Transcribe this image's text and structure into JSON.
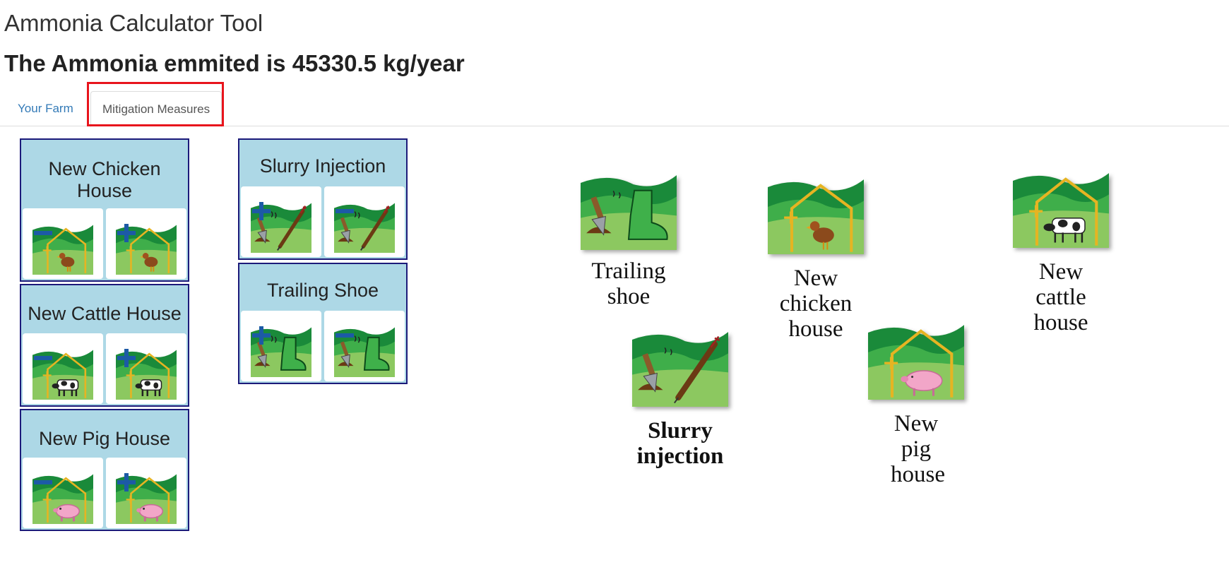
{
  "app": {
    "title": "Ammonia Calculator Tool",
    "result_text": "The Ammonia emmited is 45330.5 kg/year"
  },
  "tabs": [
    {
      "label": "Your Farm",
      "active": false
    },
    {
      "label": "Mitigation Measures",
      "active": true
    }
  ],
  "measure_cards": [
    {
      "title": "New Chicken House",
      "buttons": [
        "minus",
        "plus"
      ],
      "icon": "chicken-house-icon"
    },
    {
      "title": "New Cattle House",
      "buttons": [
        "minus",
        "plus"
      ],
      "icon": "cattle-house-icon"
    },
    {
      "title": "New Pig House",
      "buttons": [
        "minus",
        "plus"
      ],
      "icon": "pig-house-icon"
    },
    {
      "title": "Slurry Injection",
      "buttons": [
        "plus",
        "minus"
      ],
      "icon": "slurry-injection-icon"
    },
    {
      "title": "Trailing Shoe",
      "buttons": [
        "plus",
        "minus"
      ],
      "icon": "trailing-shoe-icon"
    }
  ],
  "map_items": [
    {
      "label": "Trailing shoe",
      "bold": false,
      "icon": "trailing-shoe-icon"
    },
    {
      "label": "New chicken house",
      "bold": false,
      "icon": "chicken-house-icon"
    },
    {
      "label": "New cattle house",
      "bold": false,
      "icon": "cattle-house-icon"
    },
    {
      "label": "Slurry injection",
      "bold": true,
      "icon": "slurry-injection-icon"
    },
    {
      "label": "New pig house",
      "bold": false,
      "icon": "pig-house-icon"
    }
  ],
  "colors": {
    "card_bg": "#add8e6",
    "card_border": "#1c1a7a",
    "tab_link": "#337ab7",
    "highlight": "#e8141c",
    "sym_blue": "#1c5aa6",
    "field_dark": "#1a8a3a",
    "field_light": "#8cc860",
    "house_outline": "#e6b422"
  }
}
